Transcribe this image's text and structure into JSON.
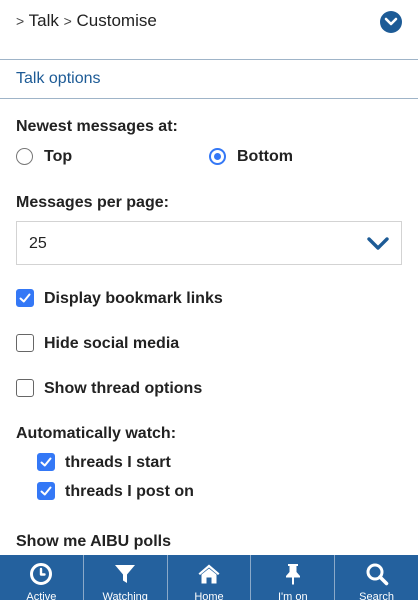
{
  "breadcrumb": {
    "sep1": ">",
    "item1": "Talk",
    "sep2": ">",
    "item2": "Customise"
  },
  "section": {
    "title": "Talk options"
  },
  "newest": {
    "label": "Newest messages at:",
    "options": [
      "Top",
      "Bottom"
    ],
    "selected": "Bottom"
  },
  "per_page": {
    "label": "Messages per page:",
    "value": "25"
  },
  "toggles": [
    {
      "label": "Display bookmark links",
      "checked": true
    },
    {
      "label": "Hide social media",
      "checked": false
    },
    {
      "label": "Show thread options",
      "checked": false
    }
  ],
  "watch": {
    "label": "Automatically watch:",
    "items": [
      {
        "label": "threads I start",
        "checked": true
      },
      {
        "label": "threads I post on",
        "checked": true
      }
    ]
  },
  "polls": {
    "label": "Show me AIBU polls"
  },
  "nav": {
    "items": [
      {
        "label": "Active",
        "icon": "clock-icon"
      },
      {
        "label": "Watching",
        "icon": "filter-icon"
      },
      {
        "label": "Home",
        "icon": "home-icon"
      },
      {
        "label": "I'm on",
        "icon": "pin-icon"
      },
      {
        "label": "Search",
        "icon": "search-icon"
      }
    ]
  },
  "colors": {
    "accent": "#1d5b96",
    "nav_bg": "#24619e",
    "control": "#3478f6"
  }
}
